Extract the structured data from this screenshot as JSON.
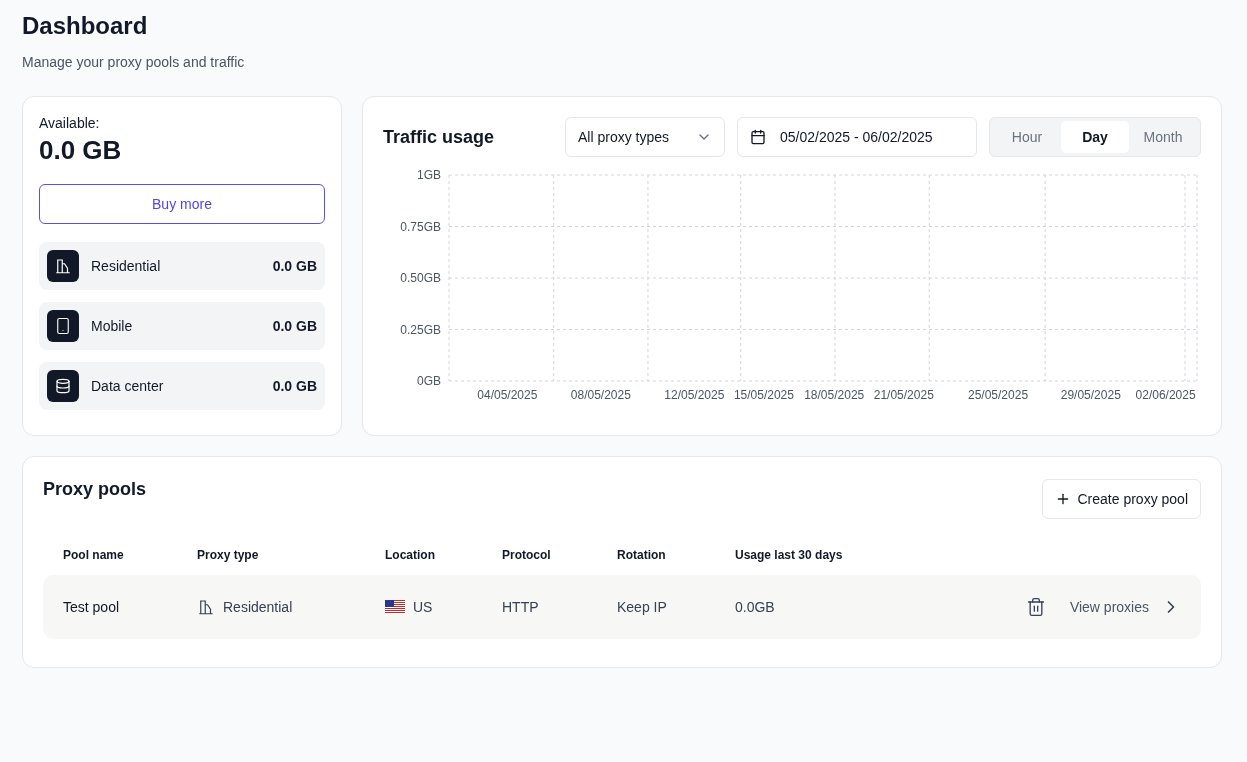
{
  "header": {
    "title": "Dashboard",
    "subtitle": "Manage your proxy pools and traffic"
  },
  "balance": {
    "label": "Available:",
    "amount": "0.0 GB",
    "buy_button": "Buy more",
    "items": [
      {
        "kind": "residential",
        "name": "Residential",
        "amount": "0.0 GB"
      },
      {
        "kind": "mobile",
        "name": "Mobile",
        "amount": "0.0 GB"
      },
      {
        "kind": "datacenter",
        "name": "Data center",
        "amount": "0.0 GB"
      }
    ]
  },
  "traffic": {
    "title": "Traffic usage",
    "type_select": "All proxy types",
    "date_range": "05/02/2025 - 06/02/2025",
    "periods": [
      {
        "label": "Hour",
        "selected": false
      },
      {
        "label": "Day",
        "selected": true
      },
      {
        "label": "Month",
        "selected": false
      }
    ],
    "chart_data": {
      "type": "line",
      "grid": true,
      "categories": [
        "04/05/2025",
        "08/05/2025",
        "12/05/2025",
        "15/05/2025",
        "18/05/2025",
        "21/05/2025",
        "25/05/2025",
        "29/05/2025",
        "02/06/2025"
      ],
      "ylim": [
        0,
        1
      ],
      "yticks": [
        {
          "value": 0,
          "label": "0GB"
        },
        {
          "value": 0.25,
          "label": "0.25GB"
        },
        {
          "value": 0.5,
          "label": "0.50GB"
        },
        {
          "value": 0.75,
          "label": "0.75GB"
        },
        {
          "value": 1,
          "label": "1GB"
        }
      ]
    }
  },
  "pools": {
    "title": "Proxy pools",
    "create_button": "Create proxy pool",
    "columns": [
      "Pool name",
      "Proxy type",
      "Location",
      "Protocol",
      "Rotation",
      "Usage last 30 days"
    ],
    "rows": [
      {
        "name": "Test pool",
        "type": "Residential",
        "location": "US",
        "protocol": "HTTP",
        "rotation": "Keep IP",
        "usage": "0.0GB",
        "action": "View proxies"
      }
    ]
  }
}
